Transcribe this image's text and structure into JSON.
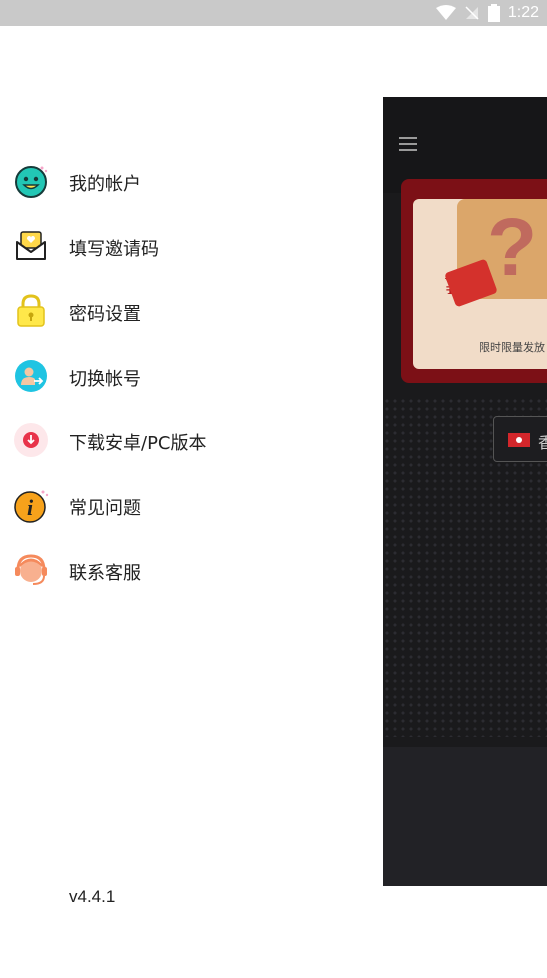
{
  "status_bar": {
    "time": "1:22"
  },
  "drawer": {
    "items": [
      {
        "label": "我的帐户",
        "icon": "smiley-face-icon"
      },
      {
        "label": "填写邀请码",
        "icon": "envelope-heart-icon"
      },
      {
        "label": "密码设置",
        "icon": "padlock-icon"
      },
      {
        "label": "切换帐号",
        "icon": "switch-user-icon"
      },
      {
        "label": "下载安卓/PC版本",
        "icon": "download-icon"
      },
      {
        "label": "常见问题",
        "icon": "info-icon"
      },
      {
        "label": "联系客服",
        "icon": "customer-service-icon"
      }
    ],
    "version": "v4.4.1"
  },
  "background_app": {
    "promo_caption": "限时限量发放",
    "promo_currency": "¥",
    "promo_mystery": "?",
    "region_label": "香"
  },
  "colors": {
    "status_bar": "#c9c9c9",
    "app_background": "#1a1a1c",
    "promo_red": "#7c1016",
    "text_primary": "#222222"
  }
}
